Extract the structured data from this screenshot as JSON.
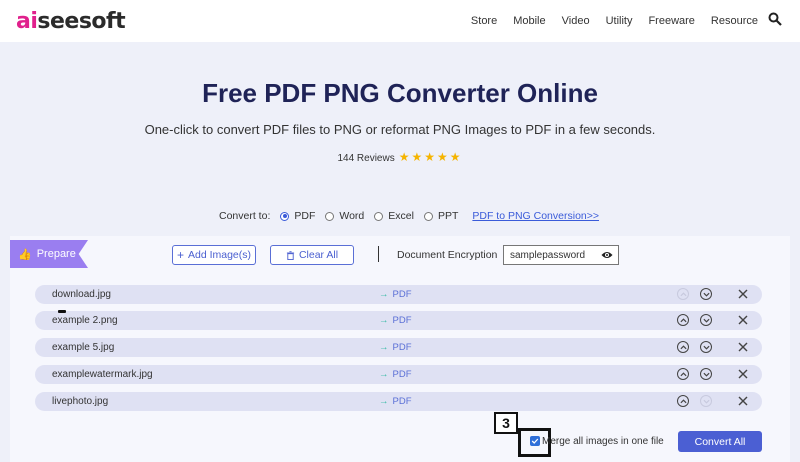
{
  "header": {
    "logo_prefix": "ai",
    "logo_rest": "seesoft",
    "nav": [
      "Store",
      "Mobile",
      "Video",
      "Utility",
      "Freeware",
      "Resource"
    ]
  },
  "hero": {
    "title": "Free PDF PNG Converter Online",
    "subtitle": "One-click to convert PDF files to PNG or reformat PNG Images to PDF in a few seconds.",
    "reviews": "144 Reviews",
    "stars": "★★★★★",
    "rating": 5
  },
  "convert": {
    "label": "Convert to:",
    "options": [
      "PDF",
      "Word",
      "Excel",
      "PPT"
    ],
    "selected": "PDF",
    "link": "PDF to PNG Conversion>>"
  },
  "toolbar": {
    "prepare_label": "Prepare",
    "add_label": "Add Image(s)",
    "clear_label": "Clear All",
    "encryption_label": "Document Encryption",
    "password_value": "samplepassword"
  },
  "files": [
    {
      "name": "download.jpg",
      "target": "PDF"
    },
    {
      "name": "example 2.png",
      "target": "PDF"
    },
    {
      "name": "example 5.jpg",
      "target": "PDF"
    },
    {
      "name": "examplewatermark.jpg",
      "target": "PDF"
    },
    {
      "name": "livephoto.jpg",
      "target": "PDF"
    }
  ],
  "bottom": {
    "step_number": "3",
    "merge_label": "Merge all images in one file",
    "merge_checked": true,
    "convert_label": "Convert All"
  },
  "colors": {
    "accent": "#4b5fd3",
    "prepare_tag": "#9a7ef0",
    "logo_accent": "#e0208c",
    "stars": "#f5b400"
  }
}
